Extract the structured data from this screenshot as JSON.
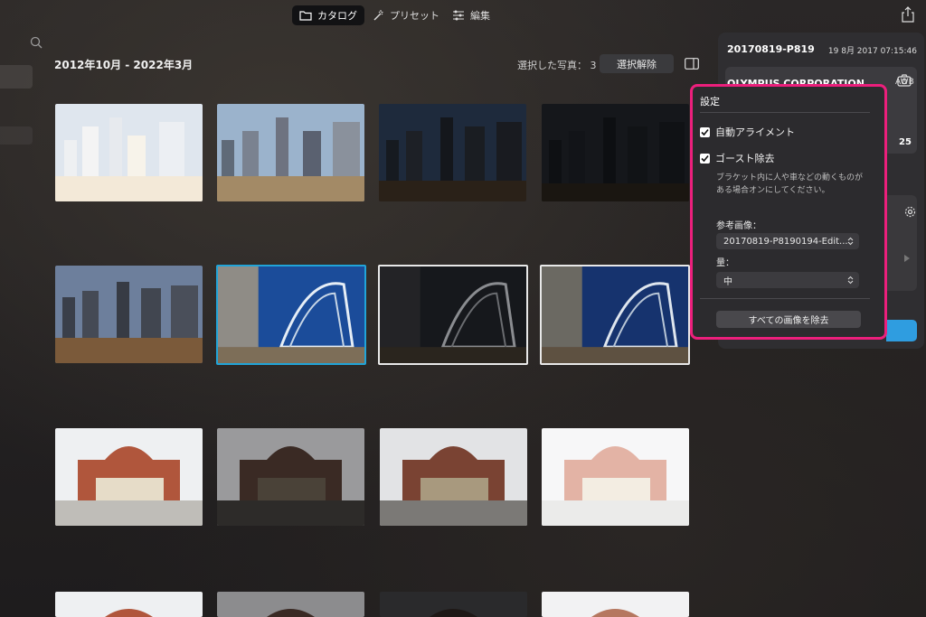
{
  "top_tabs": [
    {
      "label": "カタログ",
      "icon": "folder-icon",
      "active": true
    },
    {
      "label": "プリセット",
      "icon": "magic-wand-icon",
      "active": false
    },
    {
      "label": "編集",
      "icon": "sliders-icon",
      "active": false
    }
  ],
  "catalog": {
    "date_range": "2012年10月 - 2022年3月",
    "selection_label": "選択した写真：",
    "selection_count": "3",
    "deselect_label": "選択解除"
  },
  "right_panel": {
    "file_name": "20170819-P819",
    "date": "19 8月 2017 07:15:46",
    "maker": "OLYMPUS CORPORATION",
    "awb": "AWB",
    "number": "25"
  },
  "settings": {
    "title": "設定",
    "auto_align_label": "自動アライメント",
    "auto_align_checked": true,
    "ghost_label": "ゴースト除去",
    "ghost_checked": true,
    "ghost_description": "ブラケット内に人や車などの動くものがある場合オンにしてください。",
    "reference_label": "参考画像：",
    "reference_value": "20170819-P8190194-Edit...",
    "amount_label": "量：",
    "amount_value": "中",
    "remove_all_label": "すべての画像を除去"
  },
  "colors": {
    "highlight_border": "#ec1f7c",
    "selected_blue": "#21a4d8",
    "accent_button": "#2f9de0"
  }
}
